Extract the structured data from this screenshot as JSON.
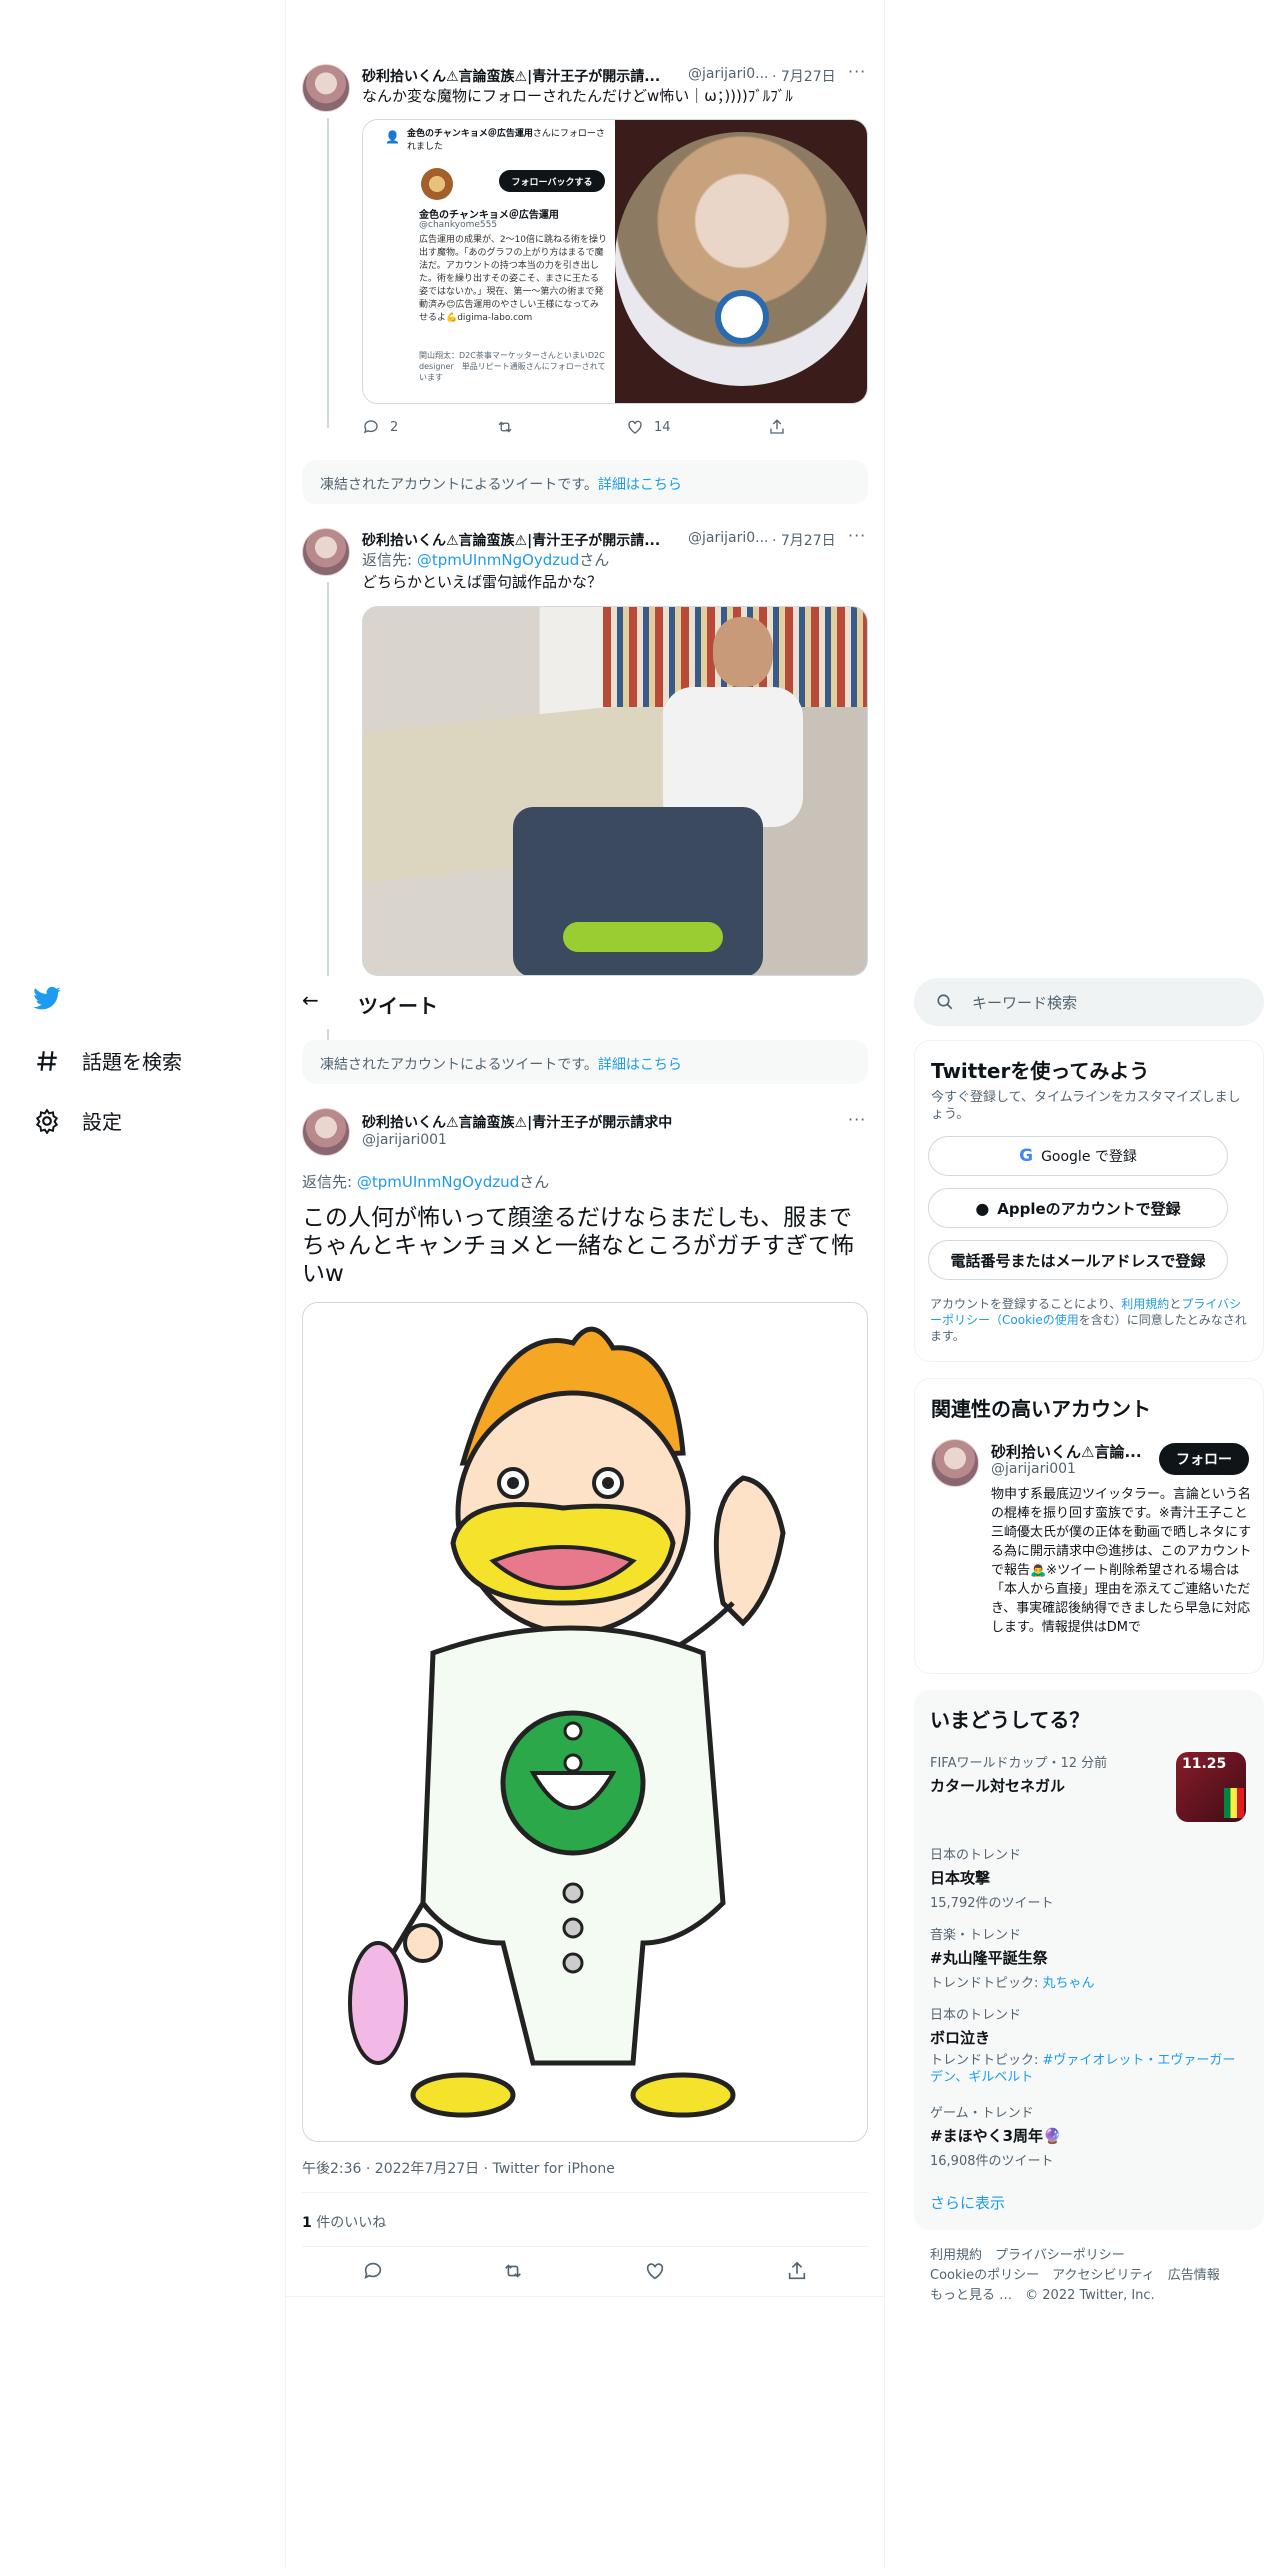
{
  "feed": {
    "tweet1": {
      "name": "砂利拾いくん⚠言論蛮族⚠|青汁王子が開示請...",
      "handle": "@jarijari0...",
      "date": "· 7月27日",
      "text": "なんか変な魔物にフォローされたんだけどw怖い｜ω；))))ﾌﾞﾙﾌﾞﾙ",
      "embed": {
        "header_name": "金色のチャンキョメ＠広告運用",
        "header_suffix": "さんにフォローされました",
        "follow_back": "フォローバックする",
        "name": "金色のチャンキョメ＠広告運用",
        "handle": "@chankyome555",
        "bio": "広告運用の成果が、2～10倍に跳ねる術を操り出す魔物。「あのグラフの上がり方はまるで魔法だ。アカウントの持つ本当の力を引き出した。術を繰り出すその姿こそ、まさに王たる姿ではないか。」現在、第一〜第六の術まで発動済み😊広告運用のやさしい王様になってみせるよ💪digima-labo.com",
        "followed_by": "関山翔太：D2C茶事マーケッターさんといまいD2C designer　単品リピート通販さんにフォローされています"
      },
      "replies": "2",
      "retweets": "",
      "likes": "14"
    },
    "notice1": {
      "text": "凍結されたアカウントによるツイートです。",
      "link": "詳細はこちら"
    },
    "tweet2": {
      "name": "砂利拾いくん⚠言論蛮族⚠|青汁王子が開示請...",
      "handle": "@jarijari0...",
      "date": "· 7月27日",
      "reply_prefix": "返信先: ",
      "reply_to": "@tpmUInmNgOydzud",
      "reply_suffix": "さん",
      "text": "どちらかといえば雷句誠作品かな？"
    },
    "notice2": {
      "text": "凍結されたアカウントによるツイートです。",
      "link": "詳細はこちら"
    },
    "main": {
      "name": "砂利拾いくん⚠言論蛮族⚠|青汁王子が開示請求中",
      "handle": "@jarijari001",
      "reply_prefix": "返信先: ",
      "reply_to": "@tpmUInmNgOydzud",
      "reply_suffix": "さん",
      "text": "この人何が怖いって顔塗るだけならまだしも、服までちゃんとキャンチョメと一緒なところがガチすぎて怖いw",
      "timestamp": "午後2:36 · 2022年7月27日 · Twitter for iPhone",
      "likes_count": "1",
      "likes_label": " 件のいいね"
    }
  },
  "header": {
    "back": "←",
    "title": "ツイート"
  },
  "nav": {
    "explore": "話題を検索",
    "settings": "設定"
  },
  "search": {
    "placeholder": "キーワード検索"
  },
  "signup": {
    "title": "Twitterを使ってみよう",
    "desc": "今すぐ登録して、タイムラインをカスタマイズしましょう。",
    "google": "Google で登録",
    "apple": "Appleのアカウントで登録",
    "phone": "電話番号またはメールアドレスで登録",
    "legal_1": "アカウントを登録することにより、",
    "legal_terms": "利用規約",
    "legal_2": "と",
    "legal_privacy": "プライバシーポリシー（Cookieの使用",
    "legal_3": "を含む）に同意したとみなされます。"
  },
  "related": {
    "title": "関連性の高いアカウント",
    "name": "砂利拾いくん⚠言論...",
    "handle": "@jarijari001",
    "follow": "フォロー",
    "bio": "物申す系最底辺ツイッタラー。言論という名の棍棒を振り回す蛮族です。※青汁王子こと三崎優太氏が僕の正体を動画で晒しネタにする為に開示請求中😊進捗は、このアカウントで報告🙇‍♂️※ツイート削除希望される場合は「本人から直接」理由を添えてご連絡いただき、事実確認後納得できましたら早急に対応します。情報提供はDMで"
  },
  "trends": {
    "title": "いまどうしてる？",
    "items": [
      {
        "category": "FIFAワールドカップ・12 分前",
        "name": "カタール対セネガル",
        "sub": "",
        "sub_link": ""
      },
      {
        "category": "日本のトレンド",
        "name": "日本攻撃",
        "sub": "15,792件のツイート",
        "sub_link": ""
      },
      {
        "category": "音楽・トレンド",
        "name": "#丸山隆平誕生祭",
        "sub": "トレンドトピック: ",
        "sub_link": "丸ちゃん"
      },
      {
        "category": "日本のトレンド",
        "name": "ボロ泣き",
        "sub": "トレンドトピック: ",
        "sub_link": "#ヴァイオレット・エヴァーガーデン、ギルベルト"
      },
      {
        "category": "ゲーム・トレンド",
        "name": "#まほやく3周年🔮",
        "sub": "16,908件のツイート",
        "sub_link": ""
      }
    ],
    "thumb_score": "11.25",
    "more": "さらに表示"
  },
  "footer": {
    "terms": "利用規約",
    "privacy": "プライバシーポリシー",
    "cookie": "Cookieのポリシー",
    "accessibility": "アクセシビリティ",
    "ads": "広告情報",
    "more": "もっと見る …",
    "copyright": "© 2022 Twitter, Inc."
  },
  "colors": {
    "accent": "#1d9bf0",
    "text": "#0f1419",
    "muted": "#536471",
    "border": "#eff3f4"
  }
}
